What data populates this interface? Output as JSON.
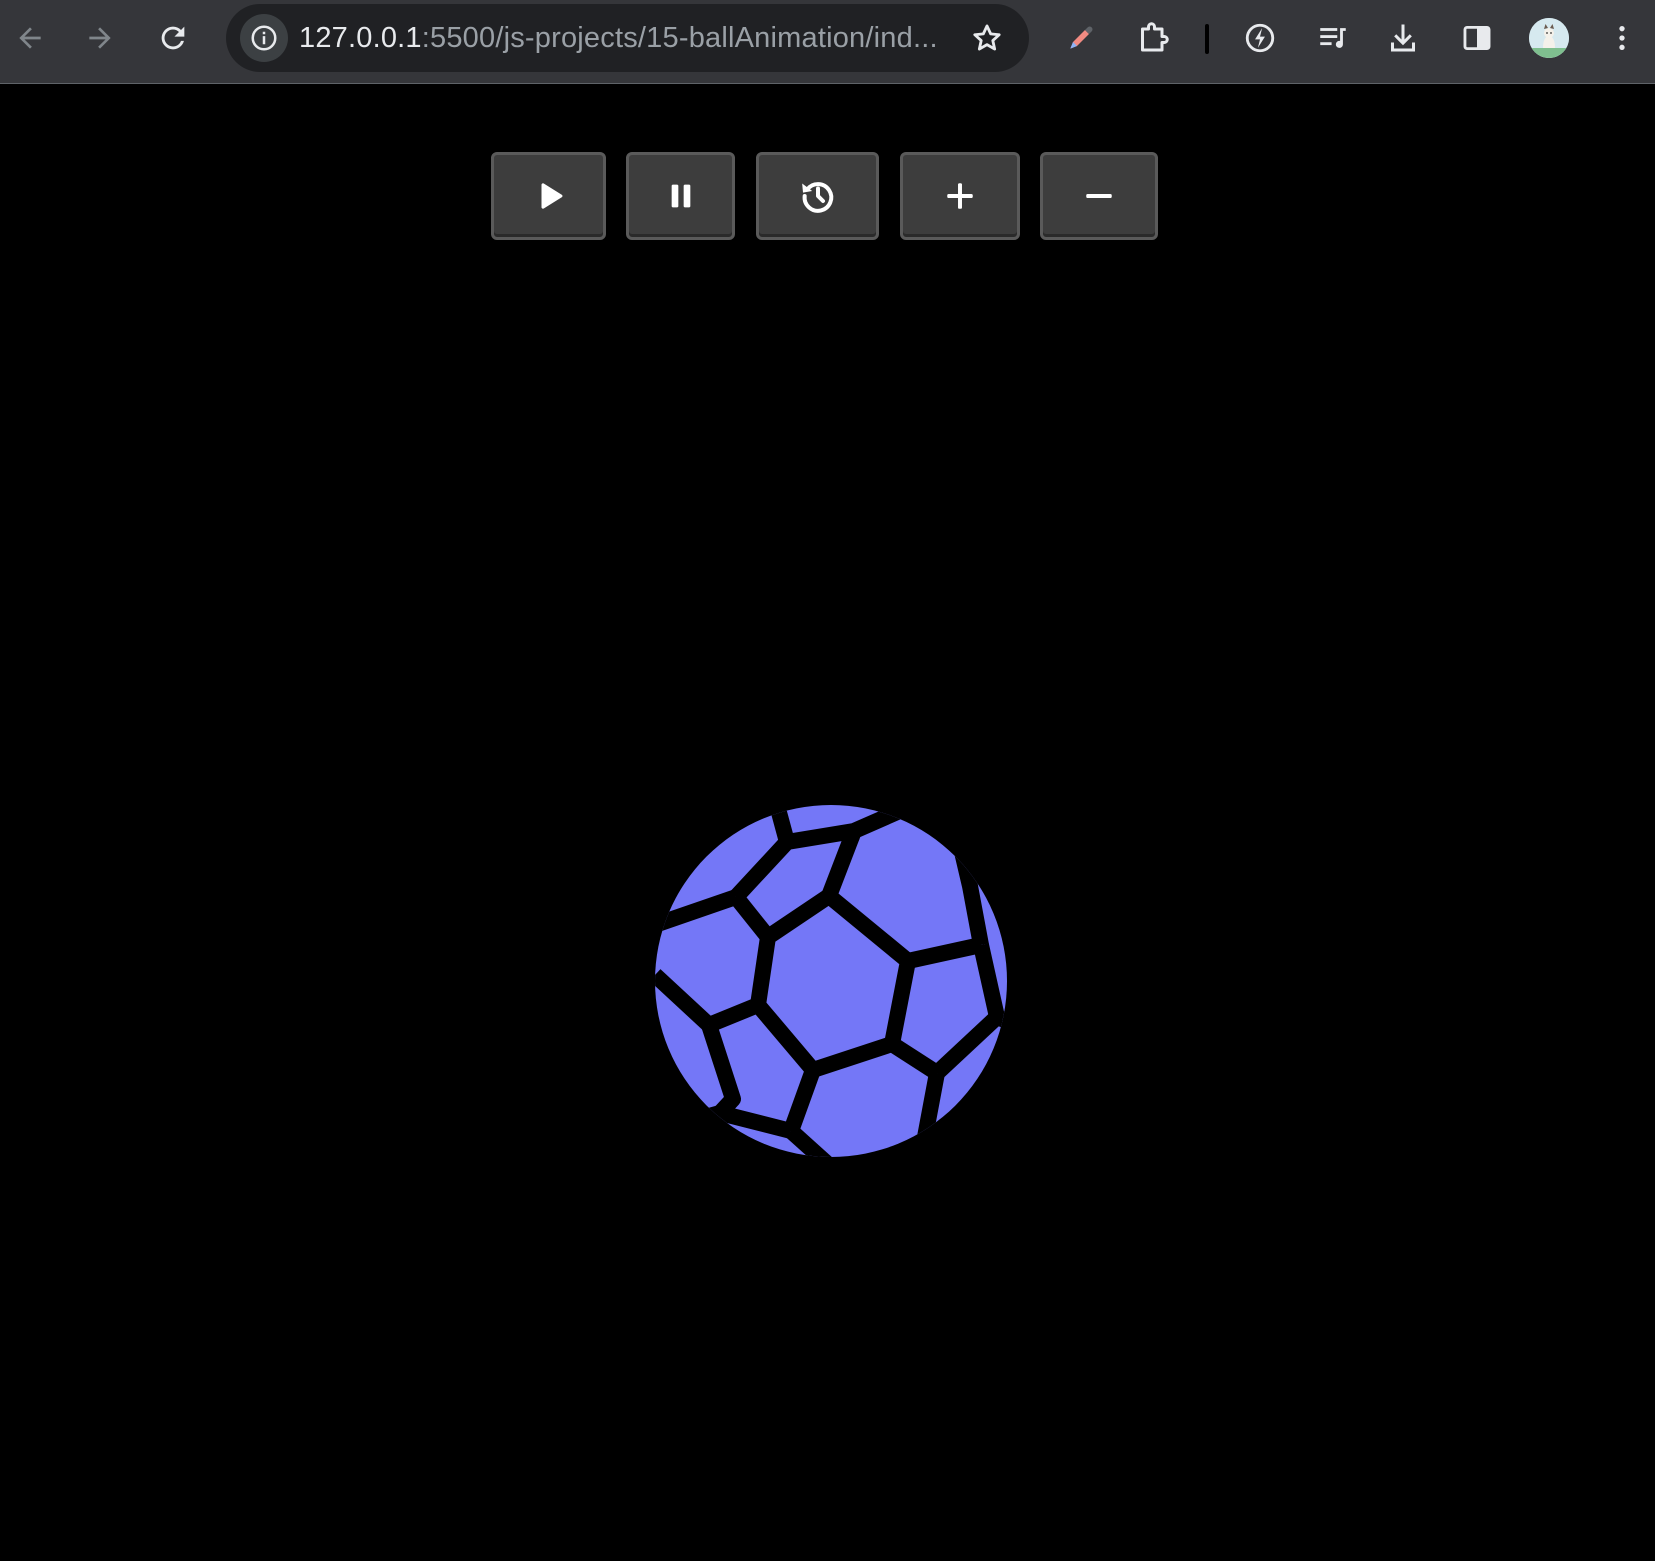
{
  "browser": {
    "url_host": "127.0.0.1",
    "url_rest": ":5500/js-projects/15-ballAnimation/ind...",
    "icons": [
      "back-arrow-icon",
      "forward-arrow-icon",
      "reload-icon",
      "site-info-icon",
      "bookmark-star-icon",
      "color-picker-extension-icon",
      "extensions-puzzle-icon",
      "lightning-extension-icon",
      "media-queue-icon",
      "download-icon",
      "side-panel-icon",
      "profile-avatar",
      "kebab-menu-icon"
    ]
  },
  "controls": {
    "buttons": [
      {
        "name": "play-button",
        "icon": "play-icon"
      },
      {
        "name": "pause-button",
        "icon": "pause-icon"
      },
      {
        "name": "reset-button",
        "icon": "history-icon"
      },
      {
        "name": "speed-up-button",
        "icon": "plus-icon"
      },
      {
        "name": "slow-down-button",
        "icon": "minus-icon"
      }
    ]
  },
  "ball": {
    "icon": "soccer-ball-icon",
    "color": "#7477f7"
  },
  "colors": {
    "page_background": "#000000",
    "toolbar_background": "#35363a",
    "button_background": "#3d3d3d"
  }
}
